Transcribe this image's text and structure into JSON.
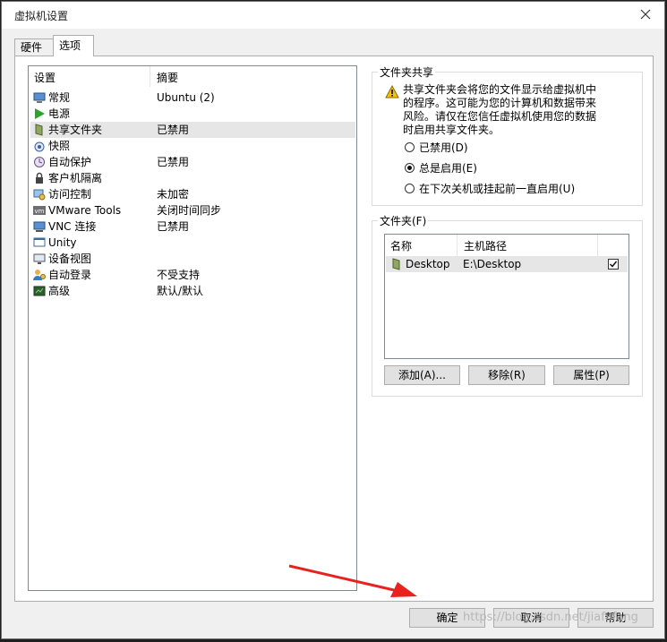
{
  "window": {
    "title": "虚拟机设置"
  },
  "tabs": [
    {
      "label": "硬件"
    },
    {
      "label": "选项"
    }
  ],
  "settings_list": {
    "headers": {
      "setting": "设置",
      "summary": "摘要"
    },
    "items": [
      {
        "name": "常规",
        "summary": "Ubuntu (2)",
        "icon": "general-icon"
      },
      {
        "name": "电源",
        "summary": "",
        "icon": "power-icon"
      },
      {
        "name": "共享文件夹",
        "summary": "已禁用",
        "icon": "shared-folder-icon"
      },
      {
        "name": "快照",
        "summary": "",
        "icon": "snapshot-icon"
      },
      {
        "name": "自动保护",
        "summary": "已禁用",
        "icon": "autoprotect-icon"
      },
      {
        "name": "客户机隔离",
        "summary": "",
        "icon": "isolation-icon"
      },
      {
        "name": "访问控制",
        "summary": "未加密",
        "icon": "access-control-icon"
      },
      {
        "name": "VMware Tools",
        "summary": "关闭时间同步",
        "icon": "vmware-tools-icon"
      },
      {
        "name": "VNC 连接",
        "summary": "已禁用",
        "icon": "vnc-icon"
      },
      {
        "name": "Unity",
        "summary": "",
        "icon": "unity-icon"
      },
      {
        "name": "设备视图",
        "summary": "",
        "icon": "device-view-icon"
      },
      {
        "name": "自动登录",
        "summary": "不受支持",
        "icon": "autologin-icon"
      },
      {
        "name": "高级",
        "summary": "默认/默认",
        "icon": "advanced-icon"
      }
    ],
    "selected": "共享文件夹"
  },
  "folder_sharing": {
    "title": "文件夹共享",
    "warning_lines": [
      "共享文件夹会将您的文件显示给虚拟机中",
      "的程序。这可能为您的计算机和数据带来",
      "风险。请仅在您信任虚拟机使用您的数据",
      "时启用共享文件夹。"
    ],
    "options": [
      {
        "label": "已禁用(D)",
        "checked": false
      },
      {
        "label": "总是启用(E)",
        "checked": true
      },
      {
        "label": "在下次关机或挂起前一直启用(U)",
        "checked": false
      }
    ]
  },
  "folders": {
    "title": "文件夹(F)",
    "headers": {
      "name": "名称",
      "host_path": "主机路径"
    },
    "rows": [
      {
        "name": "Desktop",
        "host_path": "E:\\Desktop",
        "enabled": true
      }
    ],
    "buttons": {
      "add": "添加(A)...",
      "remove": "移除(R)",
      "properties": "属性(P)"
    }
  },
  "footer": {
    "ok": "确定",
    "cancel": "取消",
    "help": "帮助"
  },
  "watermark": "https://blog.csdn.net/jiafafang",
  "colors": {
    "selection": "#e6e6e6",
    "annotation_arrow": "#e8231f",
    "warning": "#f5c400"
  }
}
